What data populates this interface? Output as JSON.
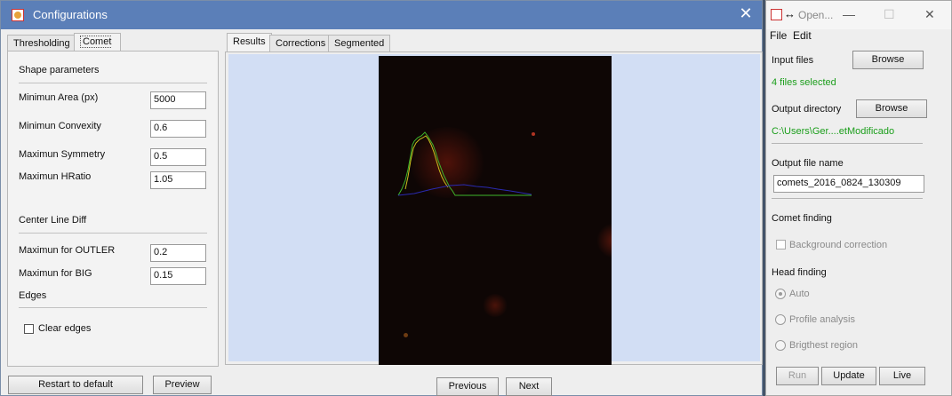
{
  "dialog": {
    "title": "Configurations",
    "close_label": "✕",
    "left_tabs": [
      {
        "label": "Thresholding"
      },
      {
        "label": "Comet Finding"
      }
    ],
    "shape_section": "Shape parameters",
    "fields": [
      {
        "label": "Minimun Area (px)",
        "value": "5000"
      },
      {
        "label": "Minimun Convexity",
        "value": "0.6"
      },
      {
        "label": "Maximun Symmetry",
        "value": "0.5"
      },
      {
        "label": "Maximun HRatio",
        "value": "1.05"
      }
    ],
    "center_section": "Center Line Diff",
    "center_fields": [
      {
        "label": "Maximun for OUTLER",
        "value": "0.2"
      },
      {
        "label": "Maximun for BIG",
        "value": "0.15"
      }
    ],
    "edges_section": "Edges",
    "clear_edges_label": "Clear edges",
    "restart_label": "Restart to default",
    "preview_label": "Preview",
    "result_tabs": [
      {
        "label": "Results"
      },
      {
        "label": "Corrections"
      },
      {
        "label": "Segmented"
      }
    ],
    "previous_label": "Previous",
    "next_label": "Next"
  },
  "side": {
    "title": "Open...",
    "menu": {
      "file": "File",
      "edit": "Edit"
    },
    "input_files_label": "Input files",
    "browse_label": "Browse",
    "files_selected": "4 files selected",
    "output_dir_label": "Output directory",
    "output_dir_value": "C:\\Users\\Ger....etModificado",
    "output_file_label": "Output file name",
    "output_file_value": "comets_2016_0824_130309",
    "comet_finding_label": "Comet finding",
    "background_correction_label": "Background correction",
    "head_finding_label": "Head finding",
    "radio_auto": "Auto",
    "radio_profile": "Profile analysis",
    "radio_brightest": "Brigthest region",
    "run_label": "Run",
    "update_label": "Update",
    "live_label": "Live"
  },
  "colors": {
    "titlebar": "#5b7fb8",
    "image_bg": "#d2def4",
    "profile_green": "#3fb52a",
    "profile_yellow": "#c9c01e",
    "profile_blue": "#2a2ab0",
    "status_green": "#1b9e1b"
  }
}
